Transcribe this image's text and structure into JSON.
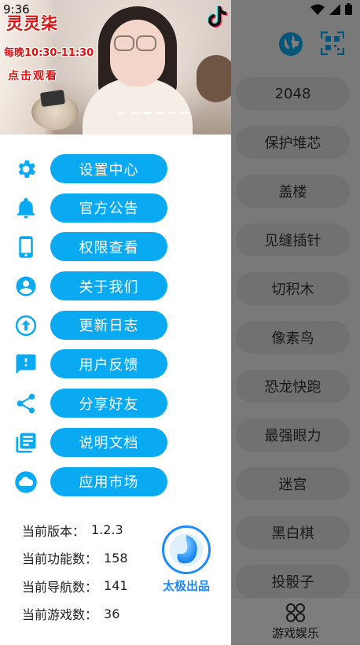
{
  "status": {
    "time": "9:36"
  },
  "games": [
    "2048",
    "保护堆芯",
    "盖楼",
    "见缝插针",
    "切积木",
    "像素鸟",
    "恐龙快跑",
    "最强眼力",
    "迷宫",
    "黑白棋",
    "投骰子"
  ],
  "bottom_nav": {
    "label": "游戏娱乐",
    "icon": "grid-icon"
  },
  "banner": {
    "title": "灵灵柒",
    "schedule": "每晚10:30-11:30",
    "cta": "点击观看",
    "slide_count": 6,
    "active_slide": 2
  },
  "menu": [
    {
      "label": "设置中心",
      "icon": "gear-icon"
    },
    {
      "label": "官方公告",
      "icon": "bell-icon"
    },
    {
      "label": "权限查看",
      "icon": "phone-icon"
    },
    {
      "label": "关于我们",
      "icon": "user-icon"
    },
    {
      "label": "更新日志",
      "icon": "upload-icon"
    },
    {
      "label": "用户反馈",
      "icon": "feedback-icon"
    },
    {
      "label": "分享好友",
      "icon": "share-icon"
    },
    {
      "label": "说明文档",
      "icon": "document-icon"
    },
    {
      "label": "应用市场",
      "icon": "cloud-icon"
    }
  ],
  "info": [
    {
      "label": "当前版本：",
      "value": "1.2.3"
    },
    {
      "label": "当前功能数：",
      "value": "158"
    },
    {
      "label": "当前导航数：",
      "value": "141"
    },
    {
      "label": "当前游戏数：",
      "value": "36"
    }
  ],
  "brand": {
    "label": "太极出品"
  },
  "colors": {
    "accent": "#0aaaf3",
    "icon": "#0aaaf3",
    "brand": "#1a86ff",
    "banner_text": "#e01010"
  }
}
